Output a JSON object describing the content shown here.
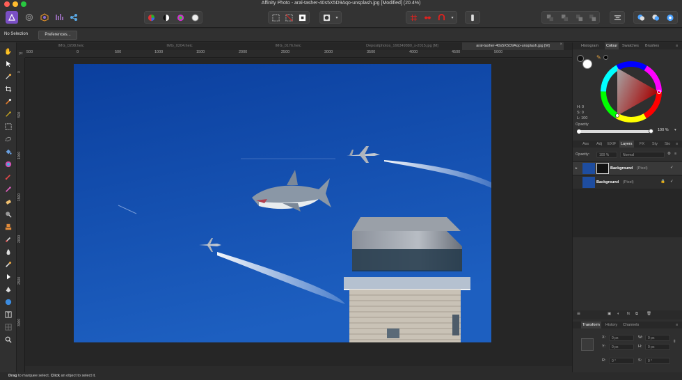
{
  "window": {
    "title": "Affinity Photo - aral-tasher-40s5X5D9Aqo-unsplash.jpg [Modified] (20.4%)"
  },
  "context_bar": {
    "selection_label": "No Selection",
    "preferences_label": "Preferences..."
  },
  "document_tabs": [
    {
      "label": "IMG_0208.heic",
      "active": false
    },
    {
      "label": "IMG_0204.heic",
      "active": false
    },
    {
      "label": "IMG_0176.heic",
      "active": false
    },
    {
      "label": "Depositphotos_166349880_s-2015.jpg [M]",
      "active": false
    },
    {
      "label": "aral-tasher-40s5X5D9Aqo-unsplash.jpg [M]",
      "active": true
    }
  ],
  "ruler": {
    "unit": "px",
    "horizontal_ticks": [
      "500",
      "0",
      "500",
      "1000",
      "1500",
      "2000",
      "2500",
      "3000",
      "3500",
      "4000",
      "4500",
      "5000"
    ],
    "vertical_ticks": [
      "0",
      "500",
      "1000",
      "1500",
      "2000",
      "2500",
      "3000"
    ]
  },
  "status_bar": {
    "drag": "Drag",
    "drag_text": " to marquee select. ",
    "click": "Click",
    "click_text": " an object to select it."
  },
  "panel_top": {
    "tabs": [
      "Histogram",
      "Colour",
      "Swatches",
      "Brushes"
    ],
    "active_tab": "Colour",
    "hsl": {
      "h": "H: 0",
      "s": "S: 0",
      "l": "L: 100"
    },
    "opacity_label": "Opacity",
    "opacity_value": "100 %"
  },
  "panel_mid": {
    "tabs": [
      "Ass",
      "Adj",
      "EXIF",
      "Layers",
      "FX",
      "Sty",
      "Sto"
    ],
    "active_tab": "Layers",
    "opacity_label": "Opacity:",
    "opacity_value": "100 %",
    "blend_mode": "Normal",
    "layers": [
      {
        "name": "Background",
        "kind": "(Pixel)",
        "visible": true,
        "locked": false,
        "expandable": true
      },
      {
        "name": "Background",
        "kind": "(Pixel)",
        "visible": true,
        "locked": true,
        "expandable": false
      }
    ]
  },
  "panel_bottom": {
    "tabs": [
      "Transform",
      "History",
      "Channels"
    ],
    "active_tab": "Transform",
    "fields": {
      "x_label": "X:",
      "x_value": "0 px",
      "y_label": "Y:",
      "y_value": "0 px",
      "w_label": "W:",
      "w_value": "0 px",
      "h_label": "H:",
      "h_value": "0 px",
      "r_label": "R:",
      "r_value": "0 °",
      "s_label": "S:",
      "s_value": "0 °"
    }
  },
  "colors": {
    "sky_top": "#0b3f9e",
    "sky_bottom": "#1d5fc0",
    "accent_red": "#e0221f",
    "close": "#ff5f57",
    "minimize": "#febc2e",
    "maximize": "#28c840"
  }
}
